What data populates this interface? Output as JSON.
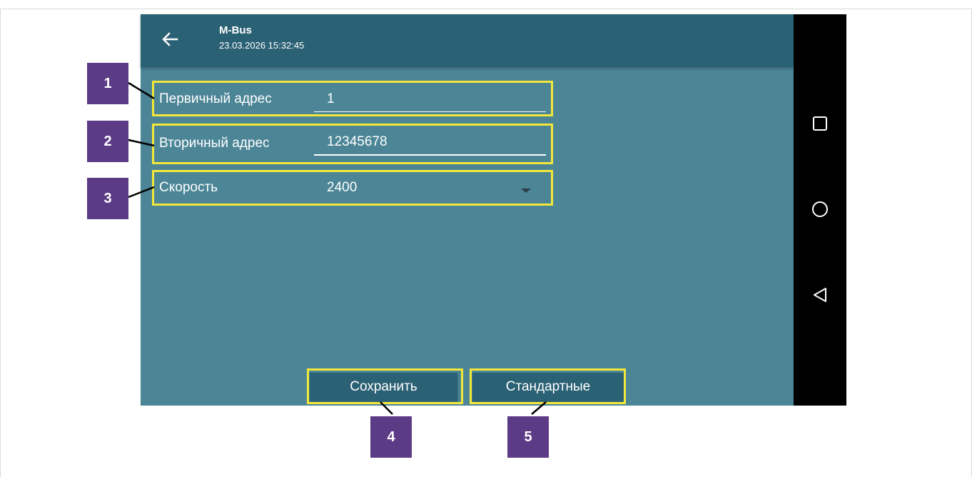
{
  "appbar": {
    "title": "M-Bus",
    "datetime": "23.03.2026 15:32:45"
  },
  "fields": {
    "primary": {
      "label": "Первичный адрес",
      "value": "1"
    },
    "secondary": {
      "label": "Вторичный адрес",
      "value": "12345678"
    },
    "speed": {
      "label": "Скорость",
      "value": "2400"
    }
  },
  "buttons": {
    "save": "Сохранить",
    "defaults": "Стандартные"
  },
  "callouts": [
    "1",
    "2",
    "3",
    "4",
    "5"
  ],
  "colors": {
    "appbar": "#2b6174",
    "screen": "#4b8596",
    "highlight": "#f3e83a",
    "badge": "#5b3a86"
  },
  "icons": {
    "back": "arrow-back-icon",
    "nav": [
      "recents-square-icon",
      "home-circle-icon",
      "back-triangle-icon"
    ]
  }
}
